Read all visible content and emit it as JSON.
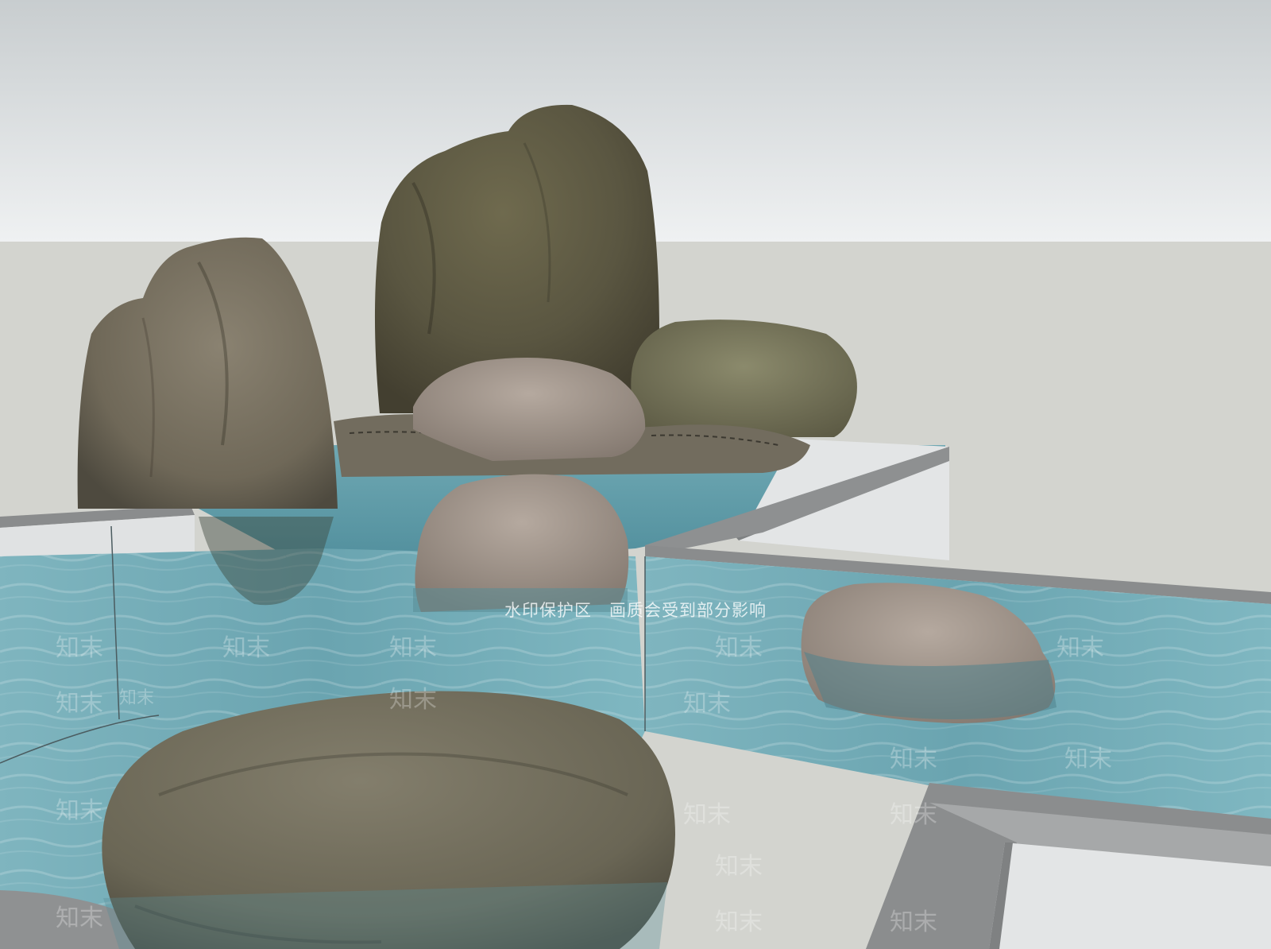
{
  "scene": {
    "description_free": true,
    "colors": {
      "sky_top": "#c9ced0",
      "sky_bottom": "#eef0f1",
      "ground": "#d4d5d0",
      "water": "#5e9aa7",
      "water_light": "#8fc3cc",
      "wall_top": "#8b8d8e",
      "wall_side": "#e4e6e7",
      "rock_dark": "#5e5a45",
      "rock_mid": "#7d7767",
      "rock_light": "#a59f92"
    }
  },
  "watermark": {
    "banner_left": "水印保护区",
    "banner_right": "画质会受到部分影响",
    "tile_text": "知末"
  }
}
